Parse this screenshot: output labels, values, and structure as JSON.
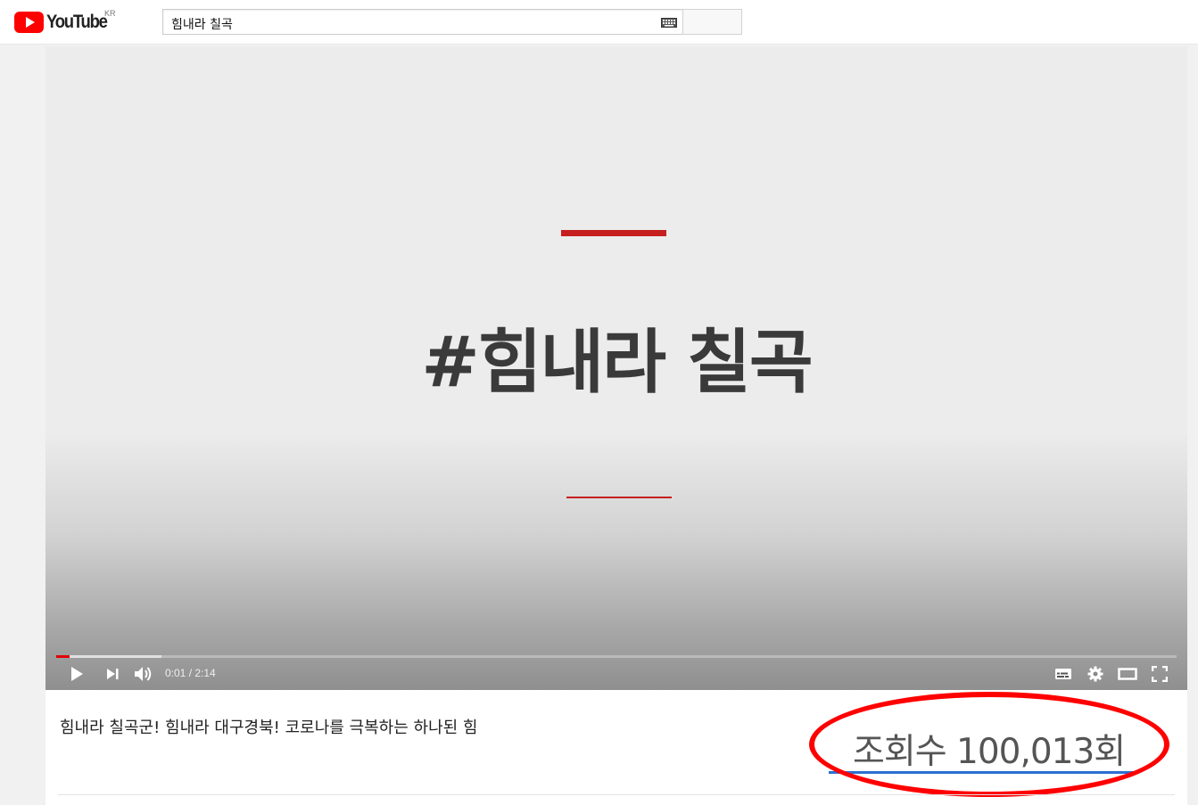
{
  "masthead": {
    "logo_text": "YouTube",
    "country_code": "KR",
    "search": {
      "value": "힘내라 칠곡",
      "placeholder": ""
    },
    "icons": {
      "keyboard": "keyboard-icon",
      "search_button": "search-button"
    }
  },
  "player": {
    "headline": "#힘내라 칠곡",
    "accent_color": "#c61f1f",
    "progress": {
      "played_fraction": 0.012,
      "loaded_fraction": 0.094,
      "played_color": "#e00000"
    },
    "time": {
      "current": "0:01",
      "separator": " / ",
      "duration": "2:14"
    },
    "controls": [
      "play-icon",
      "next-icon",
      "volume-icon",
      "subtitles-icon",
      "settings-icon",
      "theater-icon",
      "fullscreen-icon"
    ]
  },
  "video_info": {
    "title": "힘내라 칠곡군! 힘내라 대구경북! 코로나를 극복하는 하나된 힘",
    "view_count": "조회수 100,013회",
    "highlight_color": "#ff0000",
    "underline_color": "#2a70d0"
  }
}
